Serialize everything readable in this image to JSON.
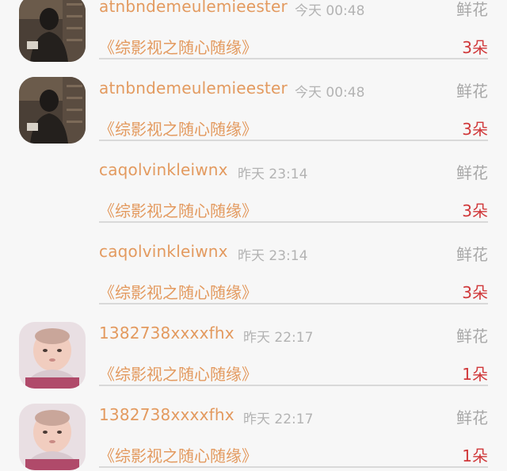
{
  "gift_list": [
    {
      "username": "atnbndemeulemieester",
      "time": "今天 00:48",
      "gift_type": "鲜花",
      "title": "《综影视之随心随缘》",
      "count": "3朵",
      "avatar": "boy-photo"
    },
    {
      "username": "atnbndemeulemieester",
      "time": "今天 00:48",
      "gift_type": "鲜花",
      "title": "《综影视之随心随缘》",
      "count": "3朵",
      "avatar": "boy-photo"
    },
    {
      "username": "caqolvinkleiwnx",
      "time": "昨天 23:14",
      "gift_type": "鲜花",
      "title": "《综影视之随心随缘》",
      "count": "3朵",
      "avatar": "none"
    },
    {
      "username": "caqolvinkleiwnx",
      "time": "昨天 23:14",
      "gift_type": "鲜花",
      "title": "《综影视之随心随缘》",
      "count": "3朵",
      "avatar": "none"
    },
    {
      "username": "1382738xxxxfhx",
      "time": "昨天 22:17",
      "gift_type": "鲜花",
      "title": "《综影视之随心随缘》",
      "count": "1朵",
      "avatar": "baby-photo"
    },
    {
      "username": "1382738xxxxfhx",
      "time": "昨天 22:17",
      "gift_type": "鲜花",
      "title": "《综影视之随心随缘》",
      "count": "1朵",
      "avatar": "baby-photo"
    }
  ]
}
